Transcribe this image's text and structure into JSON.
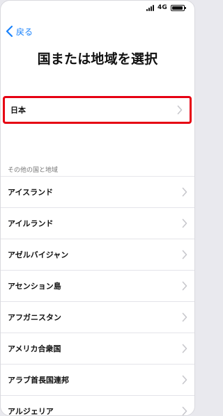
{
  "status_bar": {
    "network": "4G"
  },
  "navigation": {
    "back_label": "戻る"
  },
  "page": {
    "title": "国または地域を選択"
  },
  "selected_country": {
    "label": "日本"
  },
  "country_list": {
    "section_header": "その他の国と地域",
    "items": [
      "アイスランド",
      "アイルランド",
      "アゼルバイジャン",
      "アセンション島",
      "アフガニスタン",
      "アメリカ合衆国",
      "アラブ首長国連邦",
      "アルジェリア"
    ]
  },
  "colors": {
    "accent_blue": "#1982fc",
    "highlight_red": "#e60012"
  },
  "icons": {
    "back": "chevron-left-icon",
    "row": "chevron-right-icon",
    "signal": "signal-strength-icon",
    "battery": "battery-icon"
  }
}
